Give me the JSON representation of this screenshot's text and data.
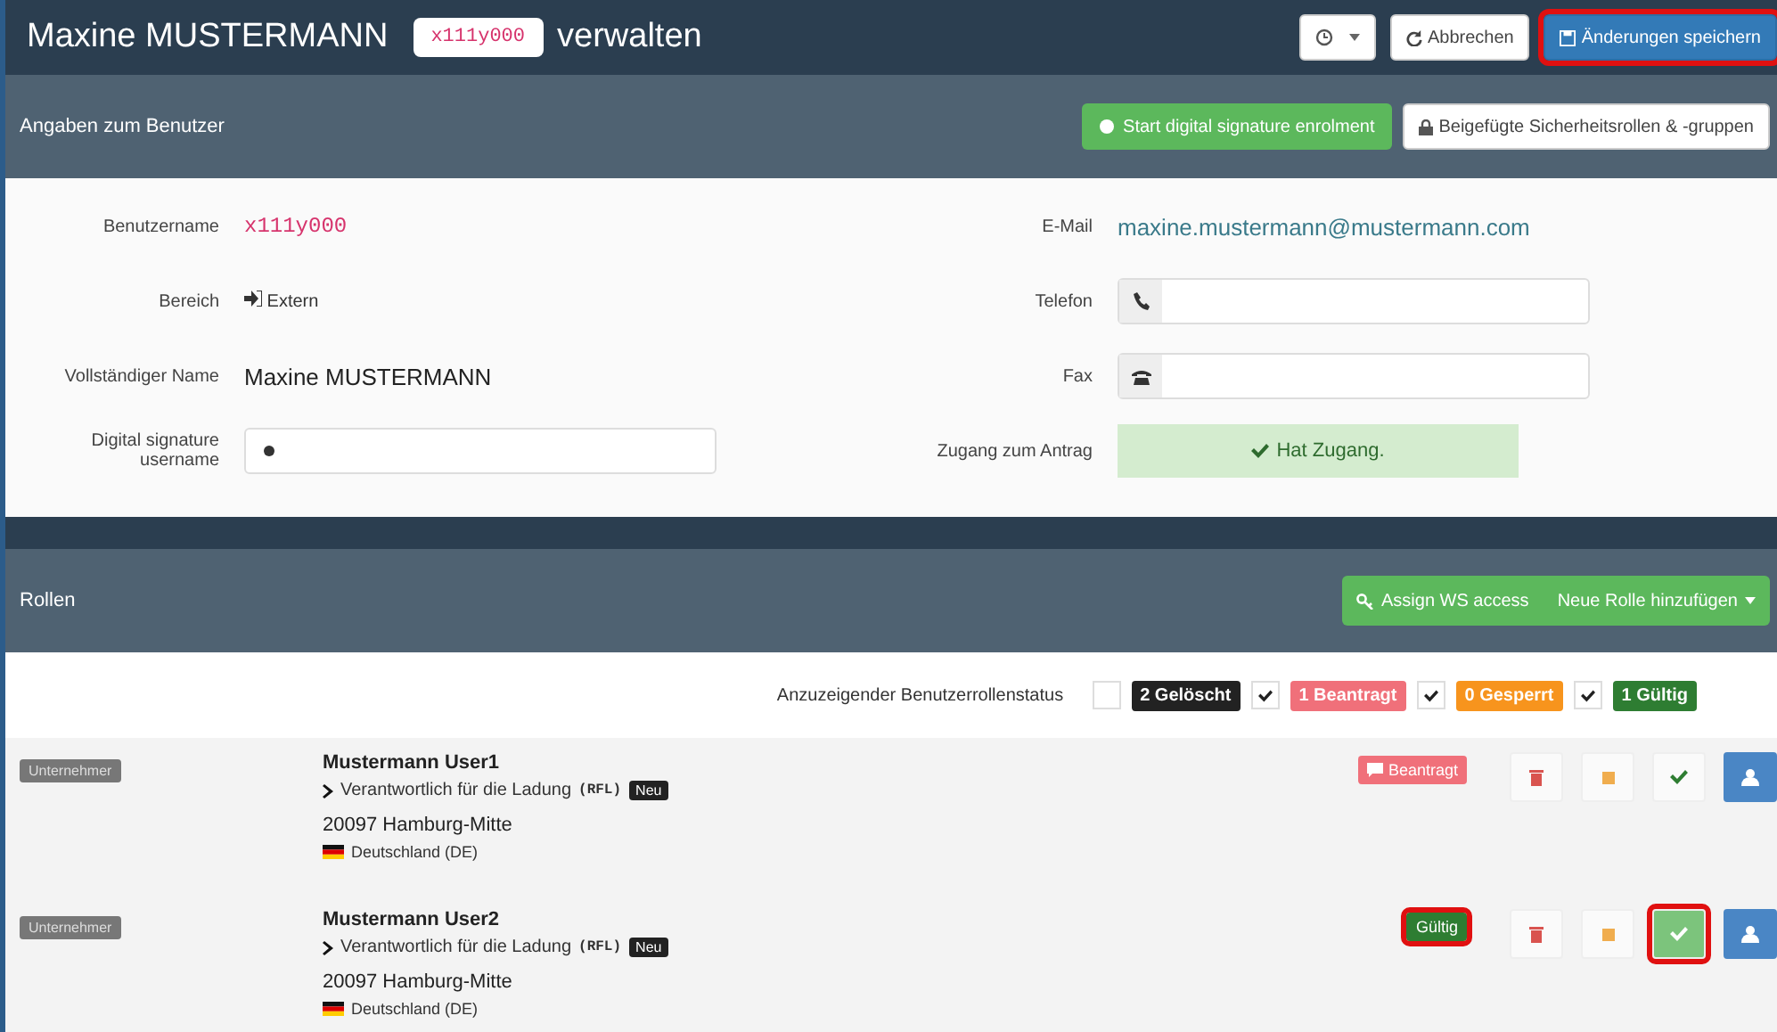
{
  "header": {
    "name": "Maxine MUSTERMANN",
    "username": "x111y000",
    "suffix": "verwalten",
    "buttons": [
      {
        "kind": "history",
        "highlighted": false
      },
      {
        "kind": "cancel",
        "label": "Abbrechen",
        "highlighted": false
      },
      {
        "kind": "save",
        "label": "Änderungen speichern",
        "highlighted": true
      }
    ]
  },
  "user_section": {
    "title": "Angaben zum Benutzer",
    "buttons": [
      {
        "kind": "enroll",
        "label": "Start digital signature enrolment"
      },
      {
        "kind": "roles",
        "label": "Beigefügte Sicherheitsrollen & -gruppen"
      }
    ]
  },
  "form_left": [
    {
      "kind": "code",
      "label": "Benutzername",
      "value": "x111y000"
    },
    {
      "kind": "scope",
      "label": "Bereich",
      "value": "Extern"
    },
    {
      "kind": "text",
      "label": "Vollständiger Name",
      "value": "Maxine MUSTERMANN"
    },
    {
      "kind": "input",
      "label": "Digital signature username"
    }
  ],
  "form_right": [
    {
      "kind": "email",
      "label": "E-Mail",
      "value": "maxine.mustermann@mustermann.com"
    },
    {
      "kind": "phone",
      "label": "Telefon"
    },
    {
      "kind": "fax",
      "label": "Fax"
    },
    {
      "kind": "access",
      "label": "Zugang zum Antrag",
      "value": "Hat Zugang."
    }
  ],
  "roles_section": {
    "title": "Rollen",
    "buttons": [
      {
        "kind": "ws",
        "label": "Assign WS access"
      },
      {
        "kind": "add",
        "label": "Neue Rolle hinzufügen"
      }
    ]
  },
  "filter": {
    "label": "Anzuzeigender Benutzerrollenstatus",
    "items": [
      {
        "label": "2 Gelöscht",
        "checked": false,
        "color": "#222222"
      },
      {
        "label": "1 Beantragt",
        "checked": true,
        "color": "#f0707a"
      },
      {
        "label": "0 Gesperrt",
        "checked": true,
        "color": "#f7941d"
      },
      {
        "label": "1 Gültig",
        "checked": true,
        "color": "#2e7d32"
      }
    ]
  },
  "roles": [
    {
      "type": "Unternehmer",
      "name": "Mustermann User1",
      "role": "Verantwortlich für die Ladung",
      "code": "(RFL)",
      "badge": "Neu",
      "city": "20097 Hamburg-Mitte",
      "country": "Deutschland (DE)",
      "status": {
        "kind": "requested",
        "label": "Beantragt",
        "highlighted": false
      },
      "check_active": false,
      "check_highlighted": false
    },
    {
      "type": "Unternehmer",
      "name": "Mustermann User2",
      "role": "Verantwortlich für die Ladung",
      "code": "(RFL)",
      "badge": "Neu",
      "city": "20097 Hamburg-Mitte",
      "country": "Deutschland (DE)",
      "status": {
        "kind": "valid",
        "label": "Gültig",
        "highlighted": true
      },
      "check_active": true,
      "check_highlighted": true
    }
  ]
}
